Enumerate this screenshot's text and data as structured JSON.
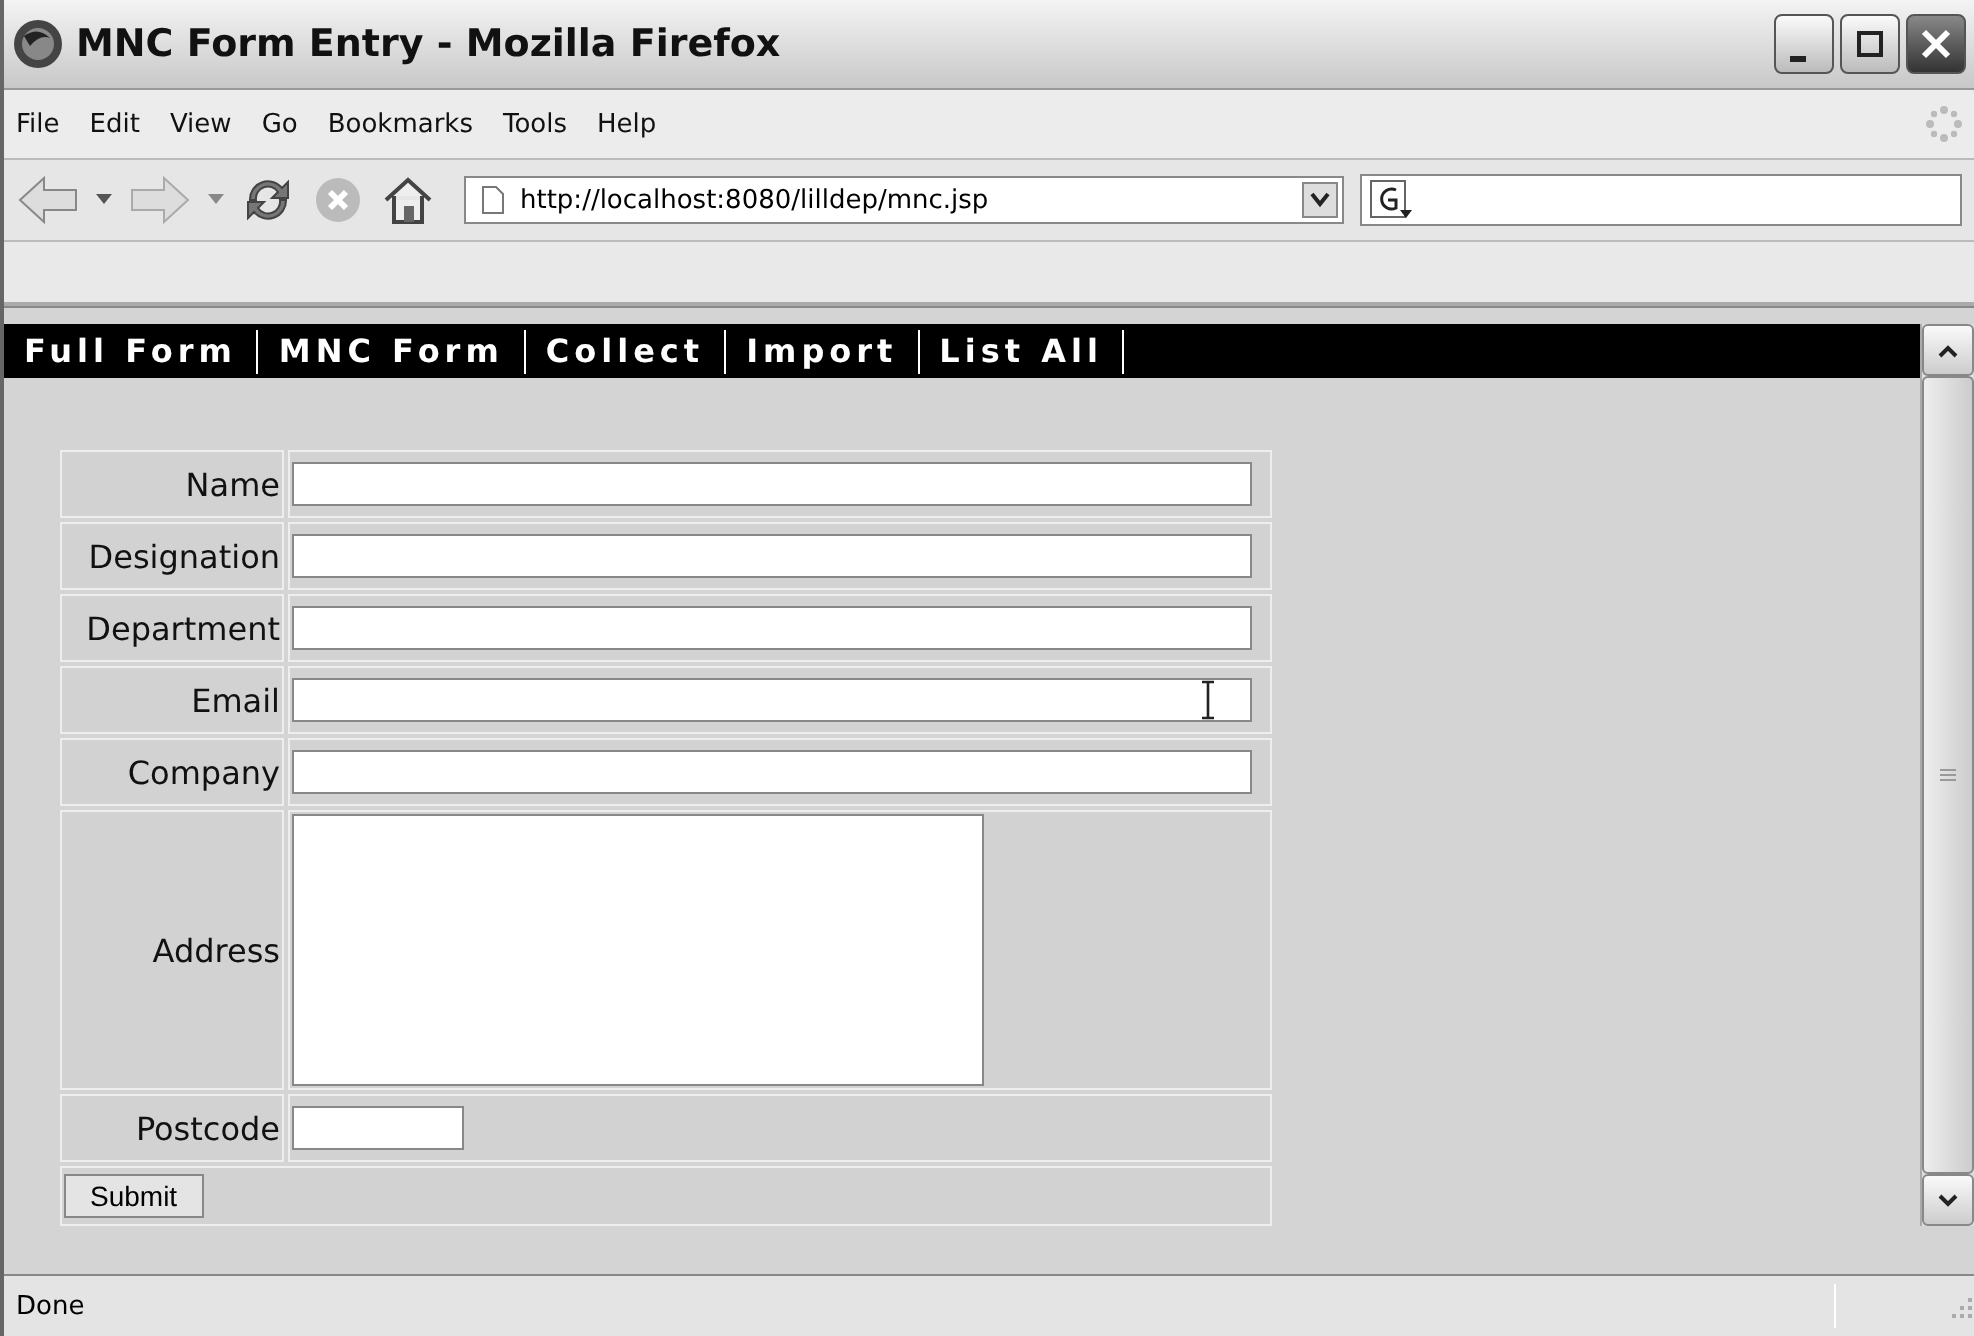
{
  "window": {
    "title": "MNC Form Entry - Mozilla Firefox"
  },
  "menu": [
    "File",
    "Edit",
    "View",
    "Go",
    "Bookmarks",
    "Tools",
    "Help"
  ],
  "address_bar": {
    "value": "http://localhost:8080/lilldep/mnc.jsp"
  },
  "nav": [
    "Full Form",
    "MNC Form",
    "Collect",
    "Import",
    "List All"
  ],
  "form": {
    "fields": [
      {
        "label": "Name",
        "kind": "text"
      },
      {
        "label": "Designation",
        "kind": "text"
      },
      {
        "label": "Department",
        "kind": "text"
      },
      {
        "label": "Email",
        "kind": "text"
      },
      {
        "label": "Company",
        "kind": "text"
      },
      {
        "label": "Address",
        "kind": "textarea"
      },
      {
        "label": "Postcode",
        "kind": "short"
      }
    ],
    "submit": "Submit"
  },
  "status_bar": {
    "text": "Done"
  }
}
